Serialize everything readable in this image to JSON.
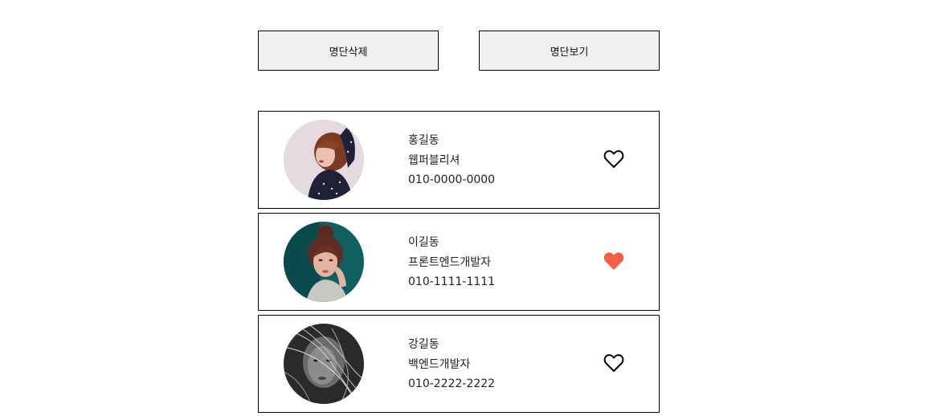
{
  "toolbar": {
    "delete_label": "명단삭제",
    "view_label": "명단보기"
  },
  "contacts": [
    {
      "name": "홍길동",
      "role": "웹퍼블리셔",
      "phone": "010-0000-0000",
      "liked": false,
      "avatar_desc": "woman-redhead-polka-dot"
    },
    {
      "name": "이길동",
      "role": "프론트엔드개발자",
      "phone": "010-1111-1111",
      "liked": true,
      "avatar_desc": "woman-teal-background"
    },
    {
      "name": "강길동",
      "role": "백엔드개발자",
      "phone": "010-2222-2222",
      "liked": false,
      "avatar_desc": "woman-grayscale-hair"
    }
  ],
  "colors": {
    "heart_liked": "#f26144",
    "heart_outline": "#000000",
    "button_bg": "#f0f0f0",
    "border": "#000000"
  },
  "icons": {
    "heart_empty": "heart-outline-icon",
    "heart_filled": "heart-filled-icon"
  }
}
